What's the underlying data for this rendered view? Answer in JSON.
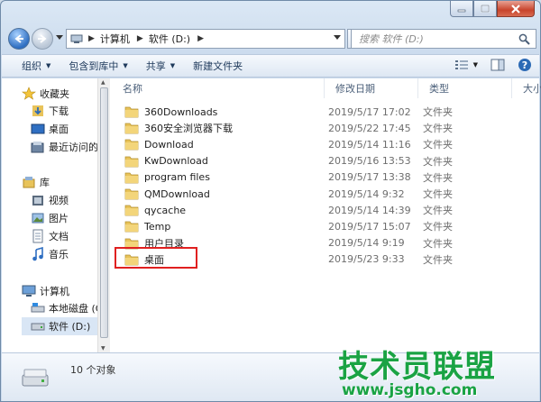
{
  "address": {
    "crumbs": [
      "计算机",
      "软件 (D:)"
    ]
  },
  "search": {
    "placeholder": "搜索 软件 (D:)"
  },
  "commands": [
    "组织",
    "包含到库中",
    "共享",
    "新建文件夹"
  ],
  "nav": {
    "favorites_header": "收藏夹",
    "favorites": [
      "下载",
      "桌面",
      "最近访问的"
    ],
    "library_header": "库",
    "libraries": [
      "视频",
      "图片",
      "文档",
      "音乐"
    ],
    "computer_header": "计算机",
    "drives": [
      "本地磁盘 (C",
      "软件 (D:)"
    ]
  },
  "columns": [
    "名称",
    "修改日期",
    "类型",
    "大小"
  ],
  "files": [
    {
      "name": "360Downloads",
      "date": "2019/5/17 17:02",
      "type": "文件夹"
    },
    {
      "name": "360安全浏览器下载",
      "date": "2019/5/22 17:45",
      "type": "文件夹"
    },
    {
      "name": "Download",
      "date": "2019/5/14 11:16",
      "type": "文件夹"
    },
    {
      "name": "KwDownload",
      "date": "2019/5/16 13:53",
      "type": "文件夹"
    },
    {
      "name": "program files",
      "date": "2019/5/17 13:38",
      "type": "文件夹"
    },
    {
      "name": "QMDownload",
      "date": "2019/5/14 9:32",
      "type": "文件夹"
    },
    {
      "name": "qycache",
      "date": "2019/5/14 14:39",
      "type": "文件夹"
    },
    {
      "name": "Temp",
      "date": "2019/5/17 15:07",
      "type": "文件夹"
    },
    {
      "name": "用户目录",
      "date": "2019/5/14 9:19",
      "type": "文件夹"
    },
    {
      "name": "桌面",
      "date": "2019/5/23 9:33",
      "type": "文件夹"
    }
  ],
  "status": {
    "count": "10 个对象"
  },
  "watermark": {
    "big": "技术员联盟",
    "small": "www.jsgho.com"
  },
  "colors": {
    "folder": "#e8c35a",
    "highlight": "#e02020",
    "watermark": "#1aa344"
  }
}
